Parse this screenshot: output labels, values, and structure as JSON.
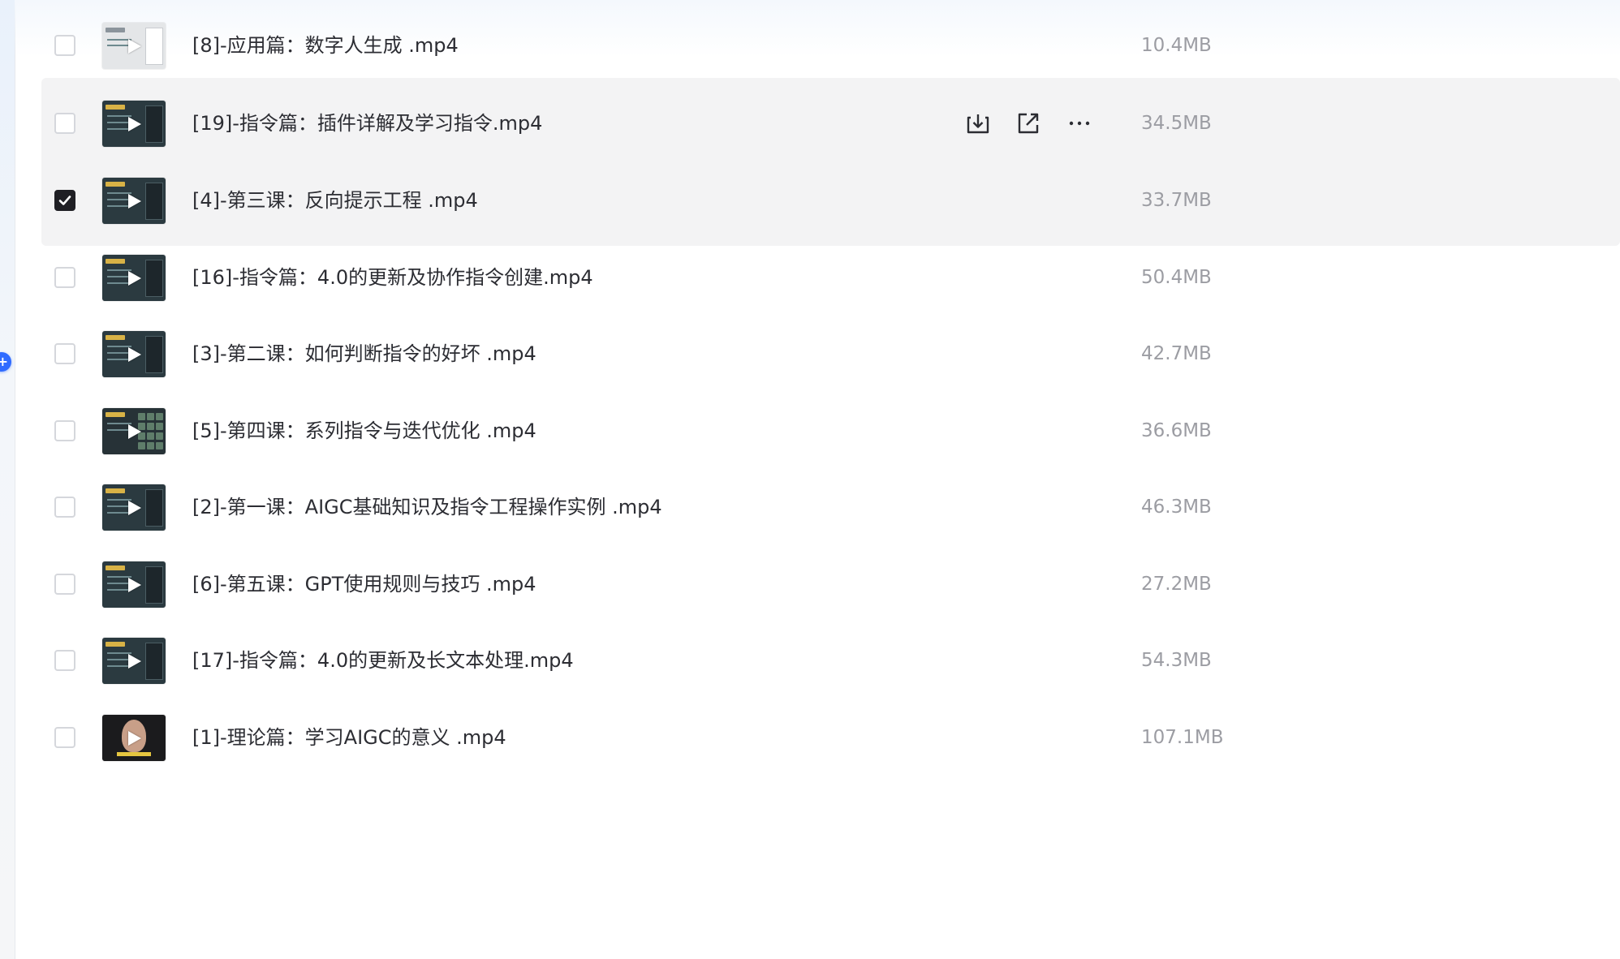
{
  "files": [
    {
      "name": "[8]-应用篇：数字人生成 .mp4",
      "size": "10.4MB",
      "checked": false,
      "state": "normal",
      "thumb_icon": "slide-thumbnail-light"
    },
    {
      "name": "[19]-指令篇：插件详解及学习指令.mp4",
      "size": "34.5MB",
      "checked": false,
      "state": "hover",
      "thumb_icon": "slide-thumbnail-dark"
    },
    {
      "name": "[4]-第三课：反向提示工程 .mp4",
      "size": "33.7MB",
      "checked": true,
      "state": "selected",
      "thumb_icon": "slide-thumbnail-dark"
    },
    {
      "name": "[16]-指令篇：4.0的更新及协作指令创建.mp4",
      "size": "50.4MB",
      "checked": false,
      "state": "normal",
      "thumb_icon": "slide-thumbnail-dark"
    },
    {
      "name": "[3]-第二课：如何判断指令的好坏 .mp4",
      "size": "42.7MB",
      "checked": false,
      "state": "normal",
      "thumb_icon": "slide-thumbnail-dark"
    },
    {
      "name": "[5]-第四课：系列指令与迭代优化 .mp4",
      "size": "36.6MB",
      "checked": false,
      "state": "normal",
      "thumb_icon": "slide-thumbnail-grid"
    },
    {
      "name": "[2]-第一课：AIGC基础知识及指令工程操作实例 .mp4",
      "size": "46.3MB",
      "checked": false,
      "state": "normal",
      "thumb_icon": "slide-thumbnail-dark"
    },
    {
      "name": "[6]-第五课：GPT使用规则与技巧 .mp4",
      "size": "27.2MB",
      "checked": false,
      "state": "normal",
      "thumb_icon": "slide-thumbnail-dark"
    },
    {
      "name": "[17]-指令篇：4.0的更新及长文本处理.mp4",
      "size": "54.3MB",
      "checked": false,
      "state": "normal",
      "thumb_icon": "slide-thumbnail-dark"
    },
    {
      "name": "[1]-理论篇：学习AIGC的意义 .mp4",
      "size": "107.1MB",
      "checked": false,
      "state": "normal",
      "thumb_icon": "speaker-thumbnail"
    }
  ],
  "row_actions": [
    "download-icon",
    "share-icon",
    "more-icon"
  ],
  "colors": {
    "row_highlight": "#f3f3f4",
    "checkbox_checked": "#1f1f24",
    "filename_text": "#2c2d33",
    "size_text": "#9c9da3",
    "accent_blue": "#2f6bff"
  }
}
